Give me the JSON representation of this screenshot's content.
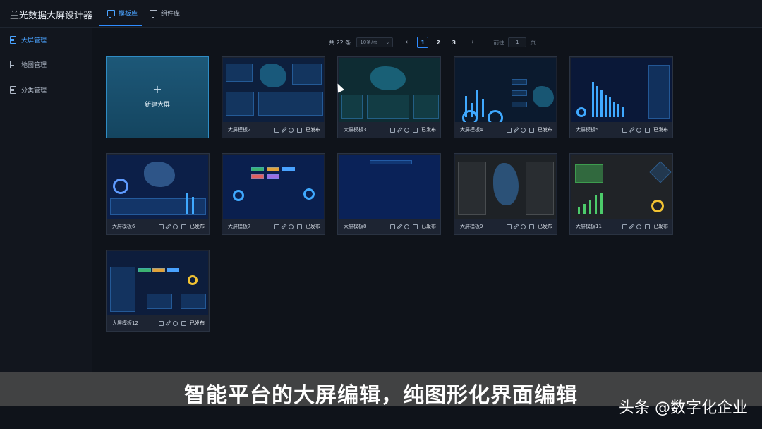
{
  "app": {
    "title": "兰光数据大屏设计器"
  },
  "tabs": [
    {
      "label": "模板库",
      "active": true
    },
    {
      "label": "组件库",
      "active": false
    }
  ],
  "sidebar": {
    "items": [
      {
        "label": "大屏管理",
        "active": true
      },
      {
        "label": "地图管理",
        "active": false
      },
      {
        "label": "分类管理",
        "active": false
      }
    ]
  },
  "pagination": {
    "total": "共 22 条",
    "page_size": "10条/页",
    "pages": [
      "1",
      "2",
      "3"
    ],
    "current_page": "1",
    "goto_label": "前往",
    "goto_value": "1",
    "goto_suffix": "页"
  },
  "new_card": {
    "plus": "+",
    "label": "新建大屏"
  },
  "templates": [
    {
      "name": "大屏模板2",
      "status": "已发布"
    },
    {
      "name": "大屏模板3",
      "status": "已发布"
    },
    {
      "name": "大屏模板4",
      "status": "已发布"
    },
    {
      "name": "大屏模板5",
      "status": "已发布"
    },
    {
      "name": "大屏模板6",
      "status": "已发布"
    },
    {
      "name": "大屏模板7",
      "status": "已发布"
    },
    {
      "name": "大屏模板8",
      "status": "已发布"
    },
    {
      "name": "大屏模板9",
      "status": "已发布"
    },
    {
      "name": "大屏模板11",
      "status": "已发布"
    },
    {
      "name": "大屏模板12",
      "status": "已发布"
    }
  ],
  "caption": "智能平台的大屏编辑，纯图形化界面编辑",
  "watermark": "头条 @数字化企业",
  "colors": {
    "accent": "#2f8cff",
    "background": "#0f131a",
    "card": "#1b2230"
  }
}
